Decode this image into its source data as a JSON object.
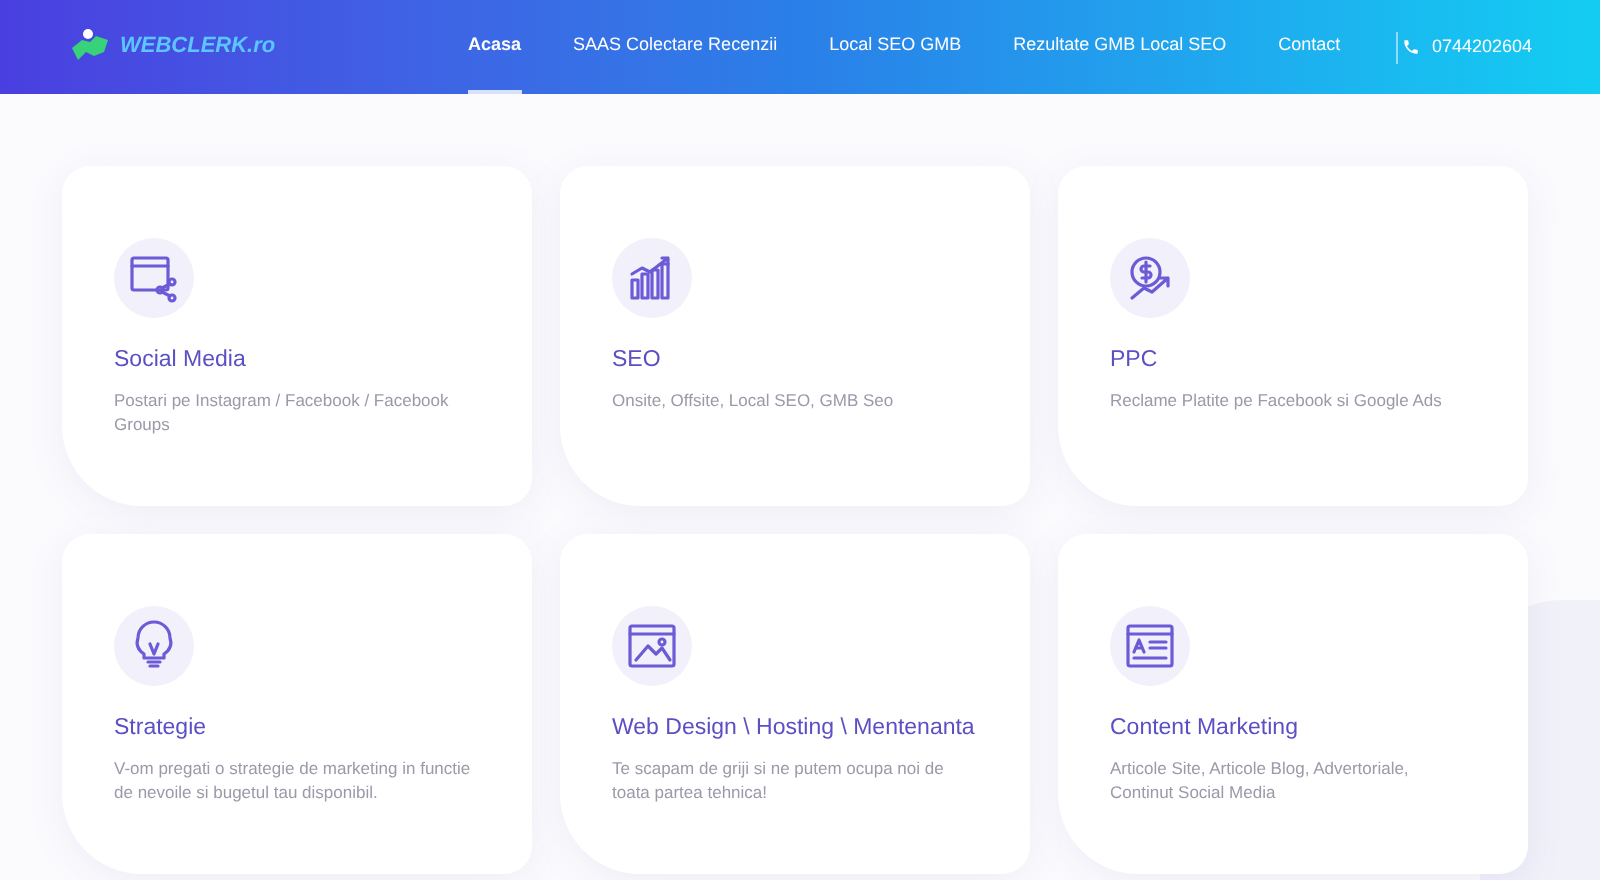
{
  "header": {
    "logo": "WEBCLERK.ro",
    "nav": [
      {
        "label": "Acasa",
        "selected": true
      },
      {
        "label": "SAAS Colectare Recenzii",
        "selected": false
      },
      {
        "label": "Local SEO GMB",
        "selected": false
      },
      {
        "label": "Rezultate GMB Local SEO",
        "selected": false
      },
      {
        "label": "Contact",
        "selected": false
      }
    ],
    "phone": "0744202604"
  },
  "services": [
    {
      "kind": "social",
      "title": "Social Media",
      "description": "Postari pe Instagram / Facebook / Facebook Groups"
    },
    {
      "kind": "seo",
      "title": "SEO",
      "description": "Onsite, Offsite, Local SEO, GMB Seo"
    },
    {
      "kind": "ppc",
      "title": "PPC",
      "description": "Reclame Platite pe Facebook si Google Ads"
    },
    {
      "kind": "strategy",
      "title": "Strategie",
      "description": "V-om pregati o strategie de marketing in functie de nevoile si bugetul tau disponibil."
    },
    {
      "kind": "web",
      "title": "Web Design \\ Hosting \\ Mentenanta",
      "description": "Te scapam de griji si ne putem ocupa noi de toata partea tehnica!"
    },
    {
      "kind": "content",
      "title": "Content Marketing",
      "description": "Articole Site, Articole Blog, Advertoriale, Continut Social Media"
    }
  ]
}
